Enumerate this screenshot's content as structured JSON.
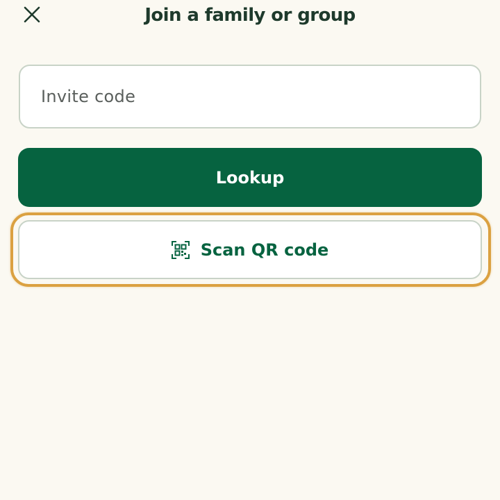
{
  "header": {
    "title": "Join a family or group",
    "close_icon": "close-icon"
  },
  "invite": {
    "placeholder": "Invite code",
    "value": ""
  },
  "actions": {
    "lookup_label": "Lookup",
    "scan_label": "Scan QR code",
    "scan_icon": "qr-code-icon"
  },
  "colors": {
    "background": "#fbf9f2",
    "primary": "#066340",
    "title": "#1e3a2c",
    "border": "#c8d3c7",
    "focus": "#dba141"
  }
}
